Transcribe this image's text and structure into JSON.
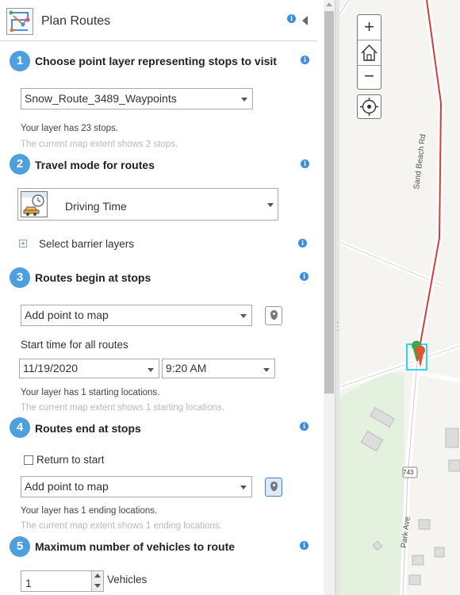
{
  "header": {
    "title": "Plan Routes"
  },
  "steps": [
    {
      "num": "1",
      "title": "Choose point layer representing stops to visit"
    },
    {
      "num": "2",
      "title": "Travel mode for routes"
    },
    {
      "num": "3",
      "title": "Routes begin at stops"
    },
    {
      "num": "4",
      "title": "Routes end at stops"
    },
    {
      "num": "5",
      "title": "Maximum number of vehicles to route"
    }
  ],
  "step1": {
    "layer_value": "Snow_Route_3489_Waypoints",
    "note_stops": "Your layer has 23 stops.",
    "note_extent": "The current map extent shows 2 stops."
  },
  "step2": {
    "travel_mode": "Driving Time",
    "barrier_label": "Select barrier layers"
  },
  "step3": {
    "start_select": "Add point to map",
    "start_time_label": "Start time for all routes",
    "date_value": "11/19/2020",
    "time_value": "9:20 AM",
    "note_locations": "Your layer has 1 starting locations.",
    "note_extent": "The current map extent shows 1 starting locations."
  },
  "step4": {
    "return_label": "Return to start",
    "end_select": "Add point to map",
    "note_locations": "Your layer has 1 ending locations.",
    "note_extent": "The current map extent shows 1 ending locations."
  },
  "step5": {
    "vehicles_value": "1",
    "vehicles_label": "Vehicles"
  },
  "map": {
    "road_label_1": "Sand Beach Rd",
    "road_label_2": "Park Ave",
    "route_shield": "743",
    "zoom_in": "+",
    "zoom_out": "−"
  },
  "colors": {
    "accent": "#4d9fde",
    "route_line": "#d93a3a",
    "selection": "#2fd6e8",
    "green_area": "#e3f1de"
  }
}
